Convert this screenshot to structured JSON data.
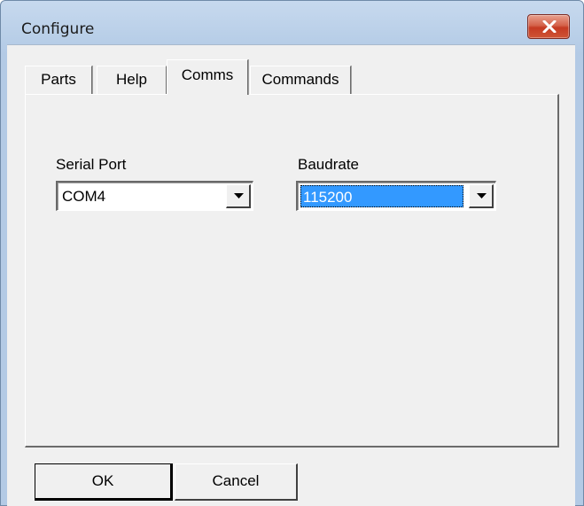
{
  "window": {
    "title": "Configure",
    "close_icon": "close-x-icon",
    "accent_title_bar": "#b9cfe8",
    "close_button_color": "#c53a22"
  },
  "tabs": [
    {
      "label": "Parts",
      "selected": false
    },
    {
      "label": "Help",
      "selected": false
    },
    {
      "label": "Comms",
      "selected": true
    },
    {
      "label": "Commands",
      "selected": false
    }
  ],
  "comms": {
    "serial_port": {
      "label": "Serial Port",
      "value": "COM4",
      "arrow_icon": "dropdown-arrow-icon"
    },
    "baudrate": {
      "label": "Baudrate",
      "value": "115200",
      "highlighted": true,
      "highlight_color": "#3399ff",
      "arrow_icon": "dropdown-arrow-icon"
    }
  },
  "buttons": {
    "ok": "OK",
    "cancel": "Cancel"
  }
}
